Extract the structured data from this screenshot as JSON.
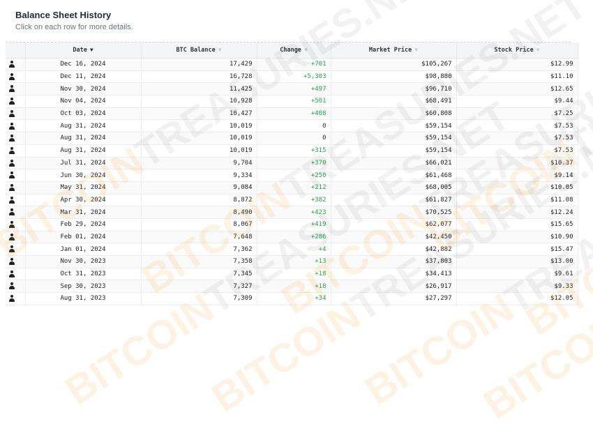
{
  "header": {
    "title": "Balance Sheet History",
    "subtitle": "Click on each row for more details."
  },
  "columns": {
    "date": "Date",
    "btc_balance": "BTC Balance",
    "change": "Change",
    "market_price": "Market Price",
    "stock_price": "Stock Price"
  },
  "rows": [
    {
      "date": "Dec 16, 2024",
      "btc": "17,429",
      "change": "+701",
      "market": "$105,267",
      "stock": "$12.99"
    },
    {
      "date": "Dec 11, 2024",
      "btc": "16,728",
      "change": "+5,303",
      "market": "$98,880",
      "stock": "$11.10"
    },
    {
      "date": "Nov 30, 2024",
      "btc": "11,425",
      "change": "+497",
      "market": "$96,710",
      "stock": "$12.65"
    },
    {
      "date": "Nov 04, 2024",
      "btc": "10,928",
      "change": "+501",
      "market": "$68,491",
      "stock": "$9.44"
    },
    {
      "date": "Oct 03, 2024",
      "btc": "10,427",
      "change": "+408",
      "market": "$60,808",
      "stock": "$7.25"
    },
    {
      "date": "Aug 31, 2024",
      "btc": "10,019",
      "change": "0",
      "market": "$59,154",
      "stock": "$7.53"
    },
    {
      "date": "Aug 31, 2024",
      "btc": "10,019",
      "change": "0",
      "market": "$59,154",
      "stock": "$7.53"
    },
    {
      "date": "Aug 31, 2024",
      "btc": "10,019",
      "change": "+315",
      "market": "$59,154",
      "stock": "$7.53"
    },
    {
      "date": "Jul 31, 2024",
      "btc": "9,704",
      "change": "+370",
      "market": "$66,021",
      "stock": "$10.37"
    },
    {
      "date": "Jun 30, 2024",
      "btc": "9,334",
      "change": "+250",
      "market": "$61,468",
      "stock": "$9.14"
    },
    {
      "date": "May 31, 2024",
      "btc": "9,084",
      "change": "+212",
      "market": "$68,005",
      "stock": "$10.05"
    },
    {
      "date": "Apr 30, 2024",
      "btc": "8,872",
      "change": "+382",
      "market": "$61,827",
      "stock": "$11.08"
    },
    {
      "date": "Mar 31, 2024",
      "btc": "8,490",
      "change": "+423",
      "market": "$70,525",
      "stock": "$12.24"
    },
    {
      "date": "Feb 29, 2024",
      "btc": "8,067",
      "change": "+419",
      "market": "$62,077",
      "stock": "$15.65"
    },
    {
      "date": "Feb 01, 2024",
      "btc": "7,648",
      "change": "+286",
      "market": "$42,450",
      "stock": "$10.90"
    },
    {
      "date": "Jan 01, 2024",
      "btc": "7,362",
      "change": "+4",
      "market": "$42,882",
      "stock": "$15.47"
    },
    {
      "date": "Nov 30, 2023",
      "btc": "7,358",
      "change": "+13",
      "market": "$37,803",
      "stock": "$13.00"
    },
    {
      "date": "Oct 31, 2023",
      "btc": "7,345",
      "change": "+18",
      "market": "$34,413",
      "stock": "$9.61"
    },
    {
      "date": "Sep 30, 2023",
      "btc": "7,327",
      "change": "+18",
      "market": "$26,917",
      "stock": "$9.33"
    },
    {
      "date": "Aug 31, 2023",
      "btc": "7,309",
      "change": "+34",
      "market": "$27,297",
      "stock": "$12.05"
    }
  ],
  "icons": {
    "row_icon": "person-icon",
    "sort_icon": "chevron-down-icon"
  },
  "colors": {
    "positive_change": "#22a447",
    "watermark_accent": "#f7931a"
  },
  "watermark": {
    "prefix": "BITCOIN",
    "suffix": "TREASURIES.NET"
  }
}
